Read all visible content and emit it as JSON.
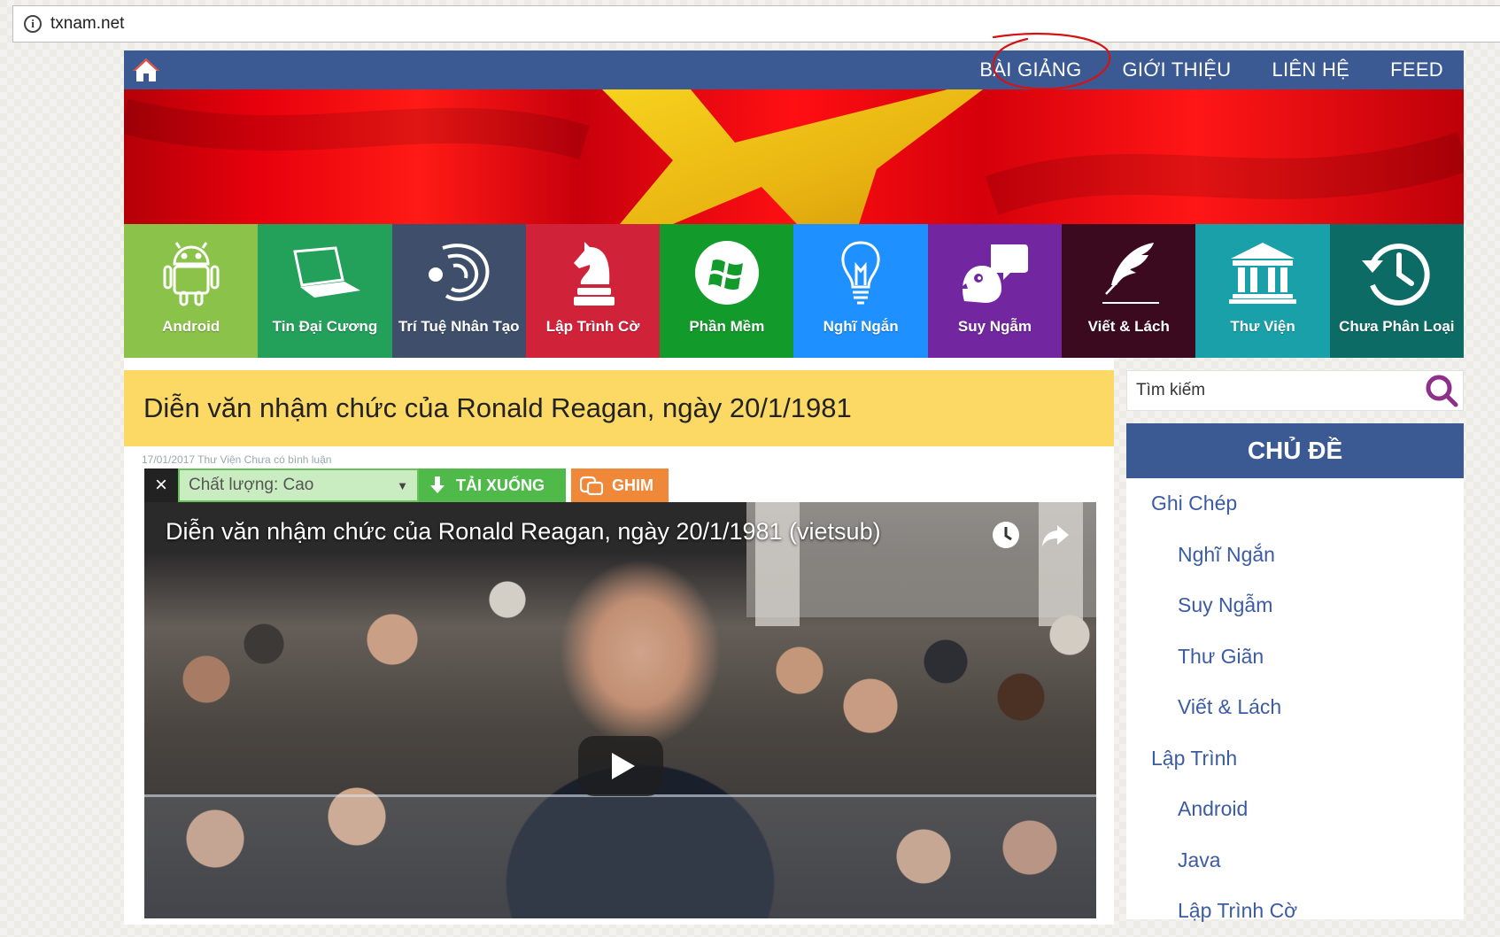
{
  "browser": {
    "url": "txnam.net"
  },
  "nav": {
    "links": [
      "BÀI GIẢNG",
      "GIỚI THIỆU",
      "LIÊN HỆ",
      "FEED"
    ],
    "color": "#3b5a94"
  },
  "categories": [
    {
      "label": "Android",
      "icon": "android-icon",
      "color": "#8bc34a"
    },
    {
      "label": "Tin Đại Cương",
      "icon": "laptop-icon",
      "color": "#23a05a"
    },
    {
      "label": "Trí Tuệ Nhân Tạo",
      "icon": "ai-head-icon",
      "color": "#3f4f6b"
    },
    {
      "label": "Lập Trình Cờ",
      "icon": "chess-knight-icon",
      "color": "#d0233a"
    },
    {
      "label": "Phần Mềm",
      "icon": "windows-icon",
      "color": "#129a2a"
    },
    {
      "label": "Nghĩ Ngắn",
      "icon": "lightbulb-icon",
      "color": "#1e90ff"
    },
    {
      "label": "Suy Ngẫm",
      "icon": "thinking-bird-icon",
      "color": "#7227a0"
    },
    {
      "label": "Viết & Lách",
      "icon": "feather-icon",
      "color": "#3c0a1e"
    },
    {
      "label": "Thư Viện",
      "icon": "library-icon",
      "color": "#1aa0a8"
    },
    {
      "label": "Chưa Phân Loại",
      "icon": "history-clock-icon",
      "color": "#0d6b66"
    }
  ],
  "post": {
    "title": "Diễn văn nhậm chức của Ronald Reagan, ngày 20/1/1981",
    "meta": "17/01/2017      Thư Viện      Chưa có bình luận"
  },
  "download_bar": {
    "close": "×",
    "quality": "Chất lượng: Cao",
    "download_label": "TẢI XUỐNG",
    "pin_label": "GHIM"
  },
  "video": {
    "title": "Diễn văn nhậm chức của Ronald Reagan, ngày 20/1/1981 (vietsub)"
  },
  "search": {
    "placeholder": "Tìm kiếm"
  },
  "sidebar": {
    "heading": "CHỦ ĐỀ",
    "topics": [
      {
        "label": "Ghi Chép",
        "level": 1
      },
      {
        "label": "Nghĩ Ngắn",
        "level": 2
      },
      {
        "label": "Suy Ngẫm",
        "level": 2
      },
      {
        "label": "Thư Giãn",
        "level": 2
      },
      {
        "label": "Viết & Lách",
        "level": 2
      },
      {
        "label": "Lập Trình",
        "level": 1
      },
      {
        "label": "Android",
        "level": 2
      },
      {
        "label": "Java",
        "level": 2
      },
      {
        "label": "Lập Trình Cờ",
        "level": 2
      }
    ]
  }
}
